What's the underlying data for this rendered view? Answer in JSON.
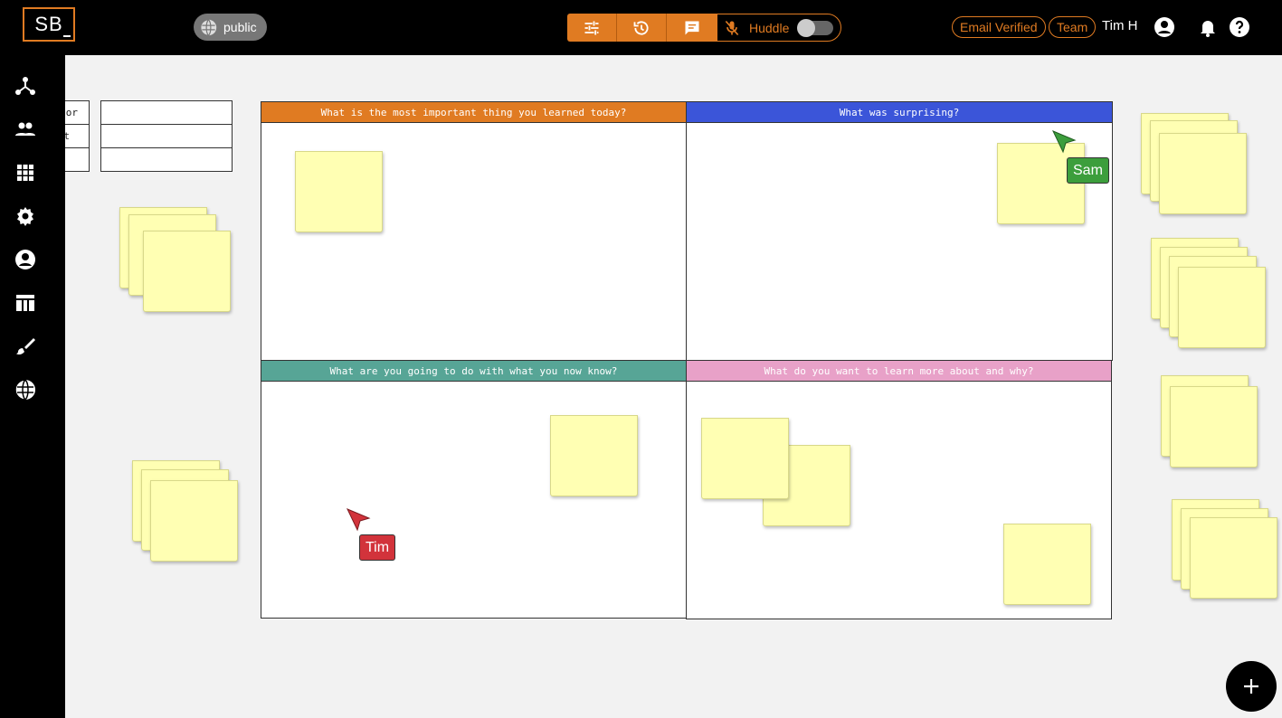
{
  "header": {
    "logo_text": "SB",
    "visibility_label": "public",
    "huddle_label": "Huddle",
    "badges": [
      "Email Verified",
      "Team"
    ],
    "username": "Tim H"
  },
  "toolbar": {
    "icons": [
      "sliders-icon",
      "history-icon",
      "chat-icon"
    ]
  },
  "sidebar": {
    "icons": [
      "hierarchy-icon",
      "users-icon",
      "grid-icon",
      "gear-icon",
      "account-icon",
      "table-layout-icon",
      "brush-icon",
      "globe-icon"
    ]
  },
  "mini_table": {
    "rows": [
      [
        "or",
        ""
      ],
      [
        "t",
        ""
      ],
      [
        "",
        ""
      ]
    ]
  },
  "board": {
    "quadrants": [
      {
        "title": "What is the most important thing you learned today?",
        "color": "#e07b22"
      },
      {
        "title": "What was surprising?",
        "color": "#3b55d9"
      },
      {
        "title": "What are you going to do with what you now know?",
        "color": "#57a596"
      },
      {
        "title": "What do you want to learn more about and why?",
        "color": "#e8a1c8"
      }
    ]
  },
  "cursors": [
    {
      "name": "Sam",
      "color": "#3c9e3c"
    },
    {
      "name": "Tim",
      "color": "#d2333b"
    }
  ],
  "colors": {
    "accent": "#e07b22",
    "note": "#ffffb3"
  }
}
